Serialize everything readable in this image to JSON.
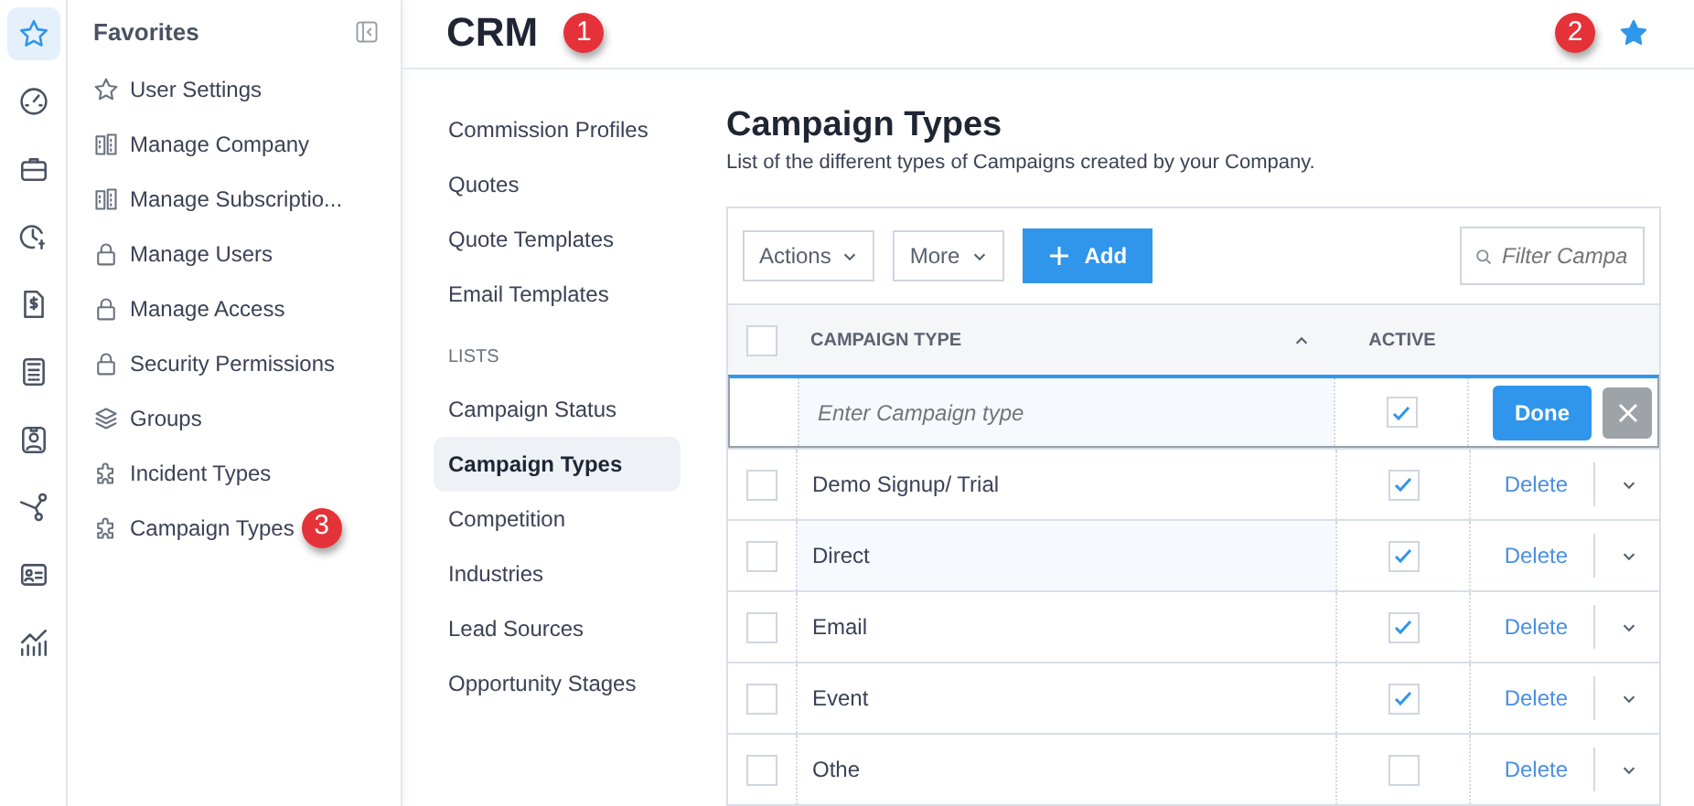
{
  "rail": [
    {
      "selected": true
    },
    {
      "selected": false
    },
    {
      "selected": false
    },
    {
      "selected": false
    },
    {
      "selected": false
    },
    {
      "selected": false
    },
    {
      "selected": false
    },
    {
      "selected": false
    },
    {
      "selected": false
    },
    {
      "selected": false
    }
  ],
  "favorites": {
    "title": "Favorites",
    "items": [
      {
        "label": "User Settings"
      },
      {
        "label": "Manage Company"
      },
      {
        "label": "Manage Subscriptio..."
      },
      {
        "label": "Manage Users"
      },
      {
        "label": "Manage Access"
      },
      {
        "label": "Security Permissions"
      },
      {
        "label": "Groups"
      },
      {
        "label": "Incident Types"
      },
      {
        "label": "Campaign Types",
        "callout": "3"
      }
    ]
  },
  "header": {
    "title": "CRM",
    "title_callout": "1",
    "favorite_callout": "2",
    "favorited": true
  },
  "subnav": [
    {
      "kind": "link",
      "label": "Commission Profiles",
      "selected": false
    },
    {
      "kind": "link",
      "label": "Quotes",
      "selected": false
    },
    {
      "kind": "link",
      "label": "Quote Templates",
      "selected": false
    },
    {
      "kind": "link",
      "label": "Email Templates",
      "selected": false
    },
    {
      "kind": "heading",
      "label": "LISTS"
    },
    {
      "kind": "link",
      "label": "Campaign Status",
      "selected": false
    },
    {
      "kind": "link",
      "label": "Campaign Types",
      "selected": true
    },
    {
      "kind": "link",
      "label": "Competition",
      "selected": false
    },
    {
      "kind": "link",
      "label": "Industries",
      "selected": false
    },
    {
      "kind": "link",
      "label": "Lead Sources",
      "selected": false
    },
    {
      "kind": "link",
      "label": "Opportunity Stages",
      "selected": false
    }
  ],
  "page": {
    "title": "Campaign Types",
    "subtitle": "List of the different types of Campaigns created by your Company."
  },
  "toolbar": {
    "actions": "Actions",
    "more": "More",
    "add": "Add",
    "filter_placeholder": "Filter Campa"
  },
  "table": {
    "columns": [
      "CAMPAIGN TYPE",
      "ACTIVE"
    ],
    "all_selected": false,
    "new_row": {
      "placeholder": "Enter Campaign type",
      "active": true,
      "done": "Done"
    },
    "rows": [
      {
        "name": "Demo Signup/ Trial",
        "selected": false,
        "active": true,
        "delete": "Delete"
      },
      {
        "name": "Direct",
        "selected": false,
        "active": true,
        "delete": "Delete"
      },
      {
        "name": "Email",
        "selected": false,
        "active": true,
        "delete": "Delete"
      },
      {
        "name": "Event",
        "selected": false,
        "active": true,
        "delete": "Delete"
      },
      {
        "name": "Othe",
        "selected": false,
        "active": false,
        "delete": "Delete"
      }
    ]
  }
}
